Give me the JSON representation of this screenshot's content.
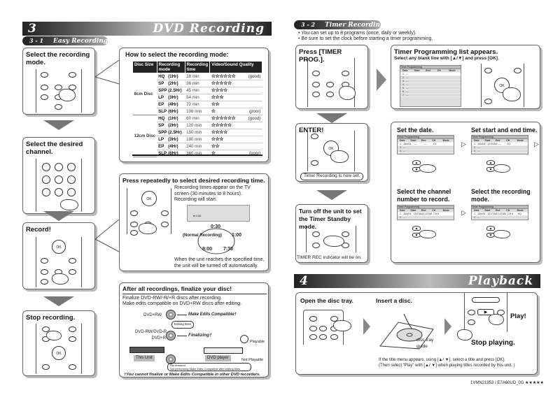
{
  "left_page": {
    "banner": {
      "number": "3",
      "title": "DVD Recording"
    },
    "section": {
      "number": "3 - 1",
      "title": "Easy Recording"
    },
    "steps": [
      {
        "title": "Select the recording mode."
      },
      {
        "title": "Select the desired channel."
      },
      {
        "title": "Record!"
      },
      {
        "title": "Stop recording."
      }
    ],
    "mode_table": {
      "title": "How to select the recording mode:",
      "headers": [
        "Disc Size",
        "Recording mode",
        "Recording time",
        "Video/Sound Quality"
      ],
      "groups": [
        {
          "disc": "8cm Disc",
          "rows": [
            {
              "mode": "HQ",
              "hr": "(1Hr)",
              "time": "18 min",
              "stars": 6,
              "note": "(good)"
            },
            {
              "mode": "SP",
              "hr": "(2Hr)",
              "time": "36 min",
              "stars": 5,
              "note": ""
            },
            {
              "mode": "SPP",
              "hr": "(2.5Hr)",
              "time": "45 min",
              "stars": 4,
              "note": ""
            },
            {
              "mode": "LP",
              "hr": "(3Hr)",
              "time": "54 min",
              "stars": 3,
              "note": ""
            },
            {
              "mode": "EP",
              "hr": "(4Hr)",
              "time": "72 min",
              "stars": 2,
              "note": ""
            },
            {
              "mode": "SLP",
              "hr": "(6Hr)",
              "time": "108 min",
              "stars": 1,
              "note": "(poor)"
            }
          ]
        },
        {
          "disc": "12cm Disc",
          "rows": [
            {
              "mode": "HQ",
              "hr": "(1Hr)",
              "time": "60 min",
              "stars": 6,
              "note": "(good)"
            },
            {
              "mode": "SP",
              "hr": "(2Hr)",
              "time": "120 min",
              "stars": 5,
              "note": ""
            },
            {
              "mode": "SPP",
              "hr": "(2.5Hr)",
              "time": "150 min",
              "stars": 4,
              "note": ""
            },
            {
              "mode": "LP",
              "hr": "(3Hr)",
              "time": "180 min",
              "stars": 3,
              "note": ""
            },
            {
              "mode": "EP",
              "hr": "(4Hr)",
              "time": "240 min",
              "stars": 2,
              "note": ""
            },
            {
              "mode": "SLP",
              "hr": "(6Hr)",
              "time": "360 min",
              "stars": 1,
              "note": "(poor)"
            }
          ]
        }
      ]
    },
    "time_panel": {
      "title": "Press repeatedly to select desired recording time.",
      "desc": "Rrecording times appear on the TV screen (30 minutes to 8 hours). Recording will start.",
      "screen_text": "● 0:30",
      "cycle": {
        "top": "0:30",
        "right": "1:00",
        "left": "(Normal Recording)",
        "bottom_left": "8:00",
        "bottom_right": "7:30"
      },
      "footer": "When the unit reaches the specified time, the unit will be turned off automatically."
    },
    "finalize_panel": {
      "title": "After all recordings, finalize your disc!",
      "line1": "Finalize DVD-RW/-R/+R discs after recording.",
      "line2": "Make edits compatible on DVD+RW discs after editing.",
      "disc1": "DVD+RW",
      "disc2": "DVD-RW/DVD-R\nDVD+R",
      "make_edits": "Make Edits Compatible†",
      "editing_titles": "Editing titles",
      "finalizing": "Finalizing†",
      "playable": "Playable",
      "not_playable": "Not Playable",
      "this_unit": "This Unit",
      "dvd_player": "DVD player",
      "not_finalized": "Not finalized",
      "not_performing": "Not performing Make Edits Compatible after editing titles",
      "footnote": "†You cannot finalize or Make Edits Compatible in other DVD recorders."
    }
  },
  "right_page": {
    "section": {
      "number": "3 - 2",
      "title": "Timer Recording"
    },
    "bullets": [
      "You can set up to 8 programs (once, daily or weekly).",
      "Be sure to set the clock before starting a timer programming."
    ],
    "step_press": "Press [TIMER PROG.].",
    "list_panel": {
      "title": "Timer Programming list appears.",
      "subtitle": "Select any blank line with [▲/▼] and press [OK]."
    },
    "tp_screen": {
      "title": "Timer Programming",
      "cols": [
        "Date",
        "Start",
        "End",
        "CH",
        "Mode"
      ],
      "rows": [
        "1.",
        "2.",
        "3.",
        "4.",
        "5.",
        "6.",
        "7."
      ]
    },
    "enter": {
      "title": "ENTER!",
      "note": "Timer Recording is now set."
    },
    "standby": {
      "title": "Turn off the unit to set the Timer Standby mode.",
      "note": "TIMER REC indicator will be on."
    },
    "substeps": [
      {
        "title": "Set the date.",
        "values": [
          "JAN/01",
          "--:--",
          "--:--",
          "E1",
          ""
        ]
      },
      {
        "title": "Set start and end time.",
        "values": [
          "JAN/01",
          "12:00AM",
          "--:--",
          "E1",
          ""
        ]
      },
      {
        "title": "Select the channel number to record.",
        "values": [
          "JAN/01",
          "12:07AM",
          "1:07AM",
          "CH 6",
          ""
        ]
      },
      {
        "title": "Select the recording mode.",
        "values": [
          "JAN/01",
          "12:07AM",
          "1:07AM",
          "CH 6",
          "HQ"
        ]
      }
    ],
    "banner": {
      "number": "4",
      "title": "Playback"
    },
    "playback": {
      "open_tray": "Open the disc tray.",
      "insert_disc": "Insert a disc.",
      "tray_guide": "disc tray guide",
      "play": "Play!",
      "stop": "Stop playing.",
      "note1": "If the title menu appears, using [▲/ ▼], select a title and press [OK].",
      "note2": "(Then select “Play” with [▲/ ▼] when playing titles recorded by this unit. )"
    },
    "footer_code": "1VMN21953 / E7A60UD_0G ★★★★★"
  }
}
